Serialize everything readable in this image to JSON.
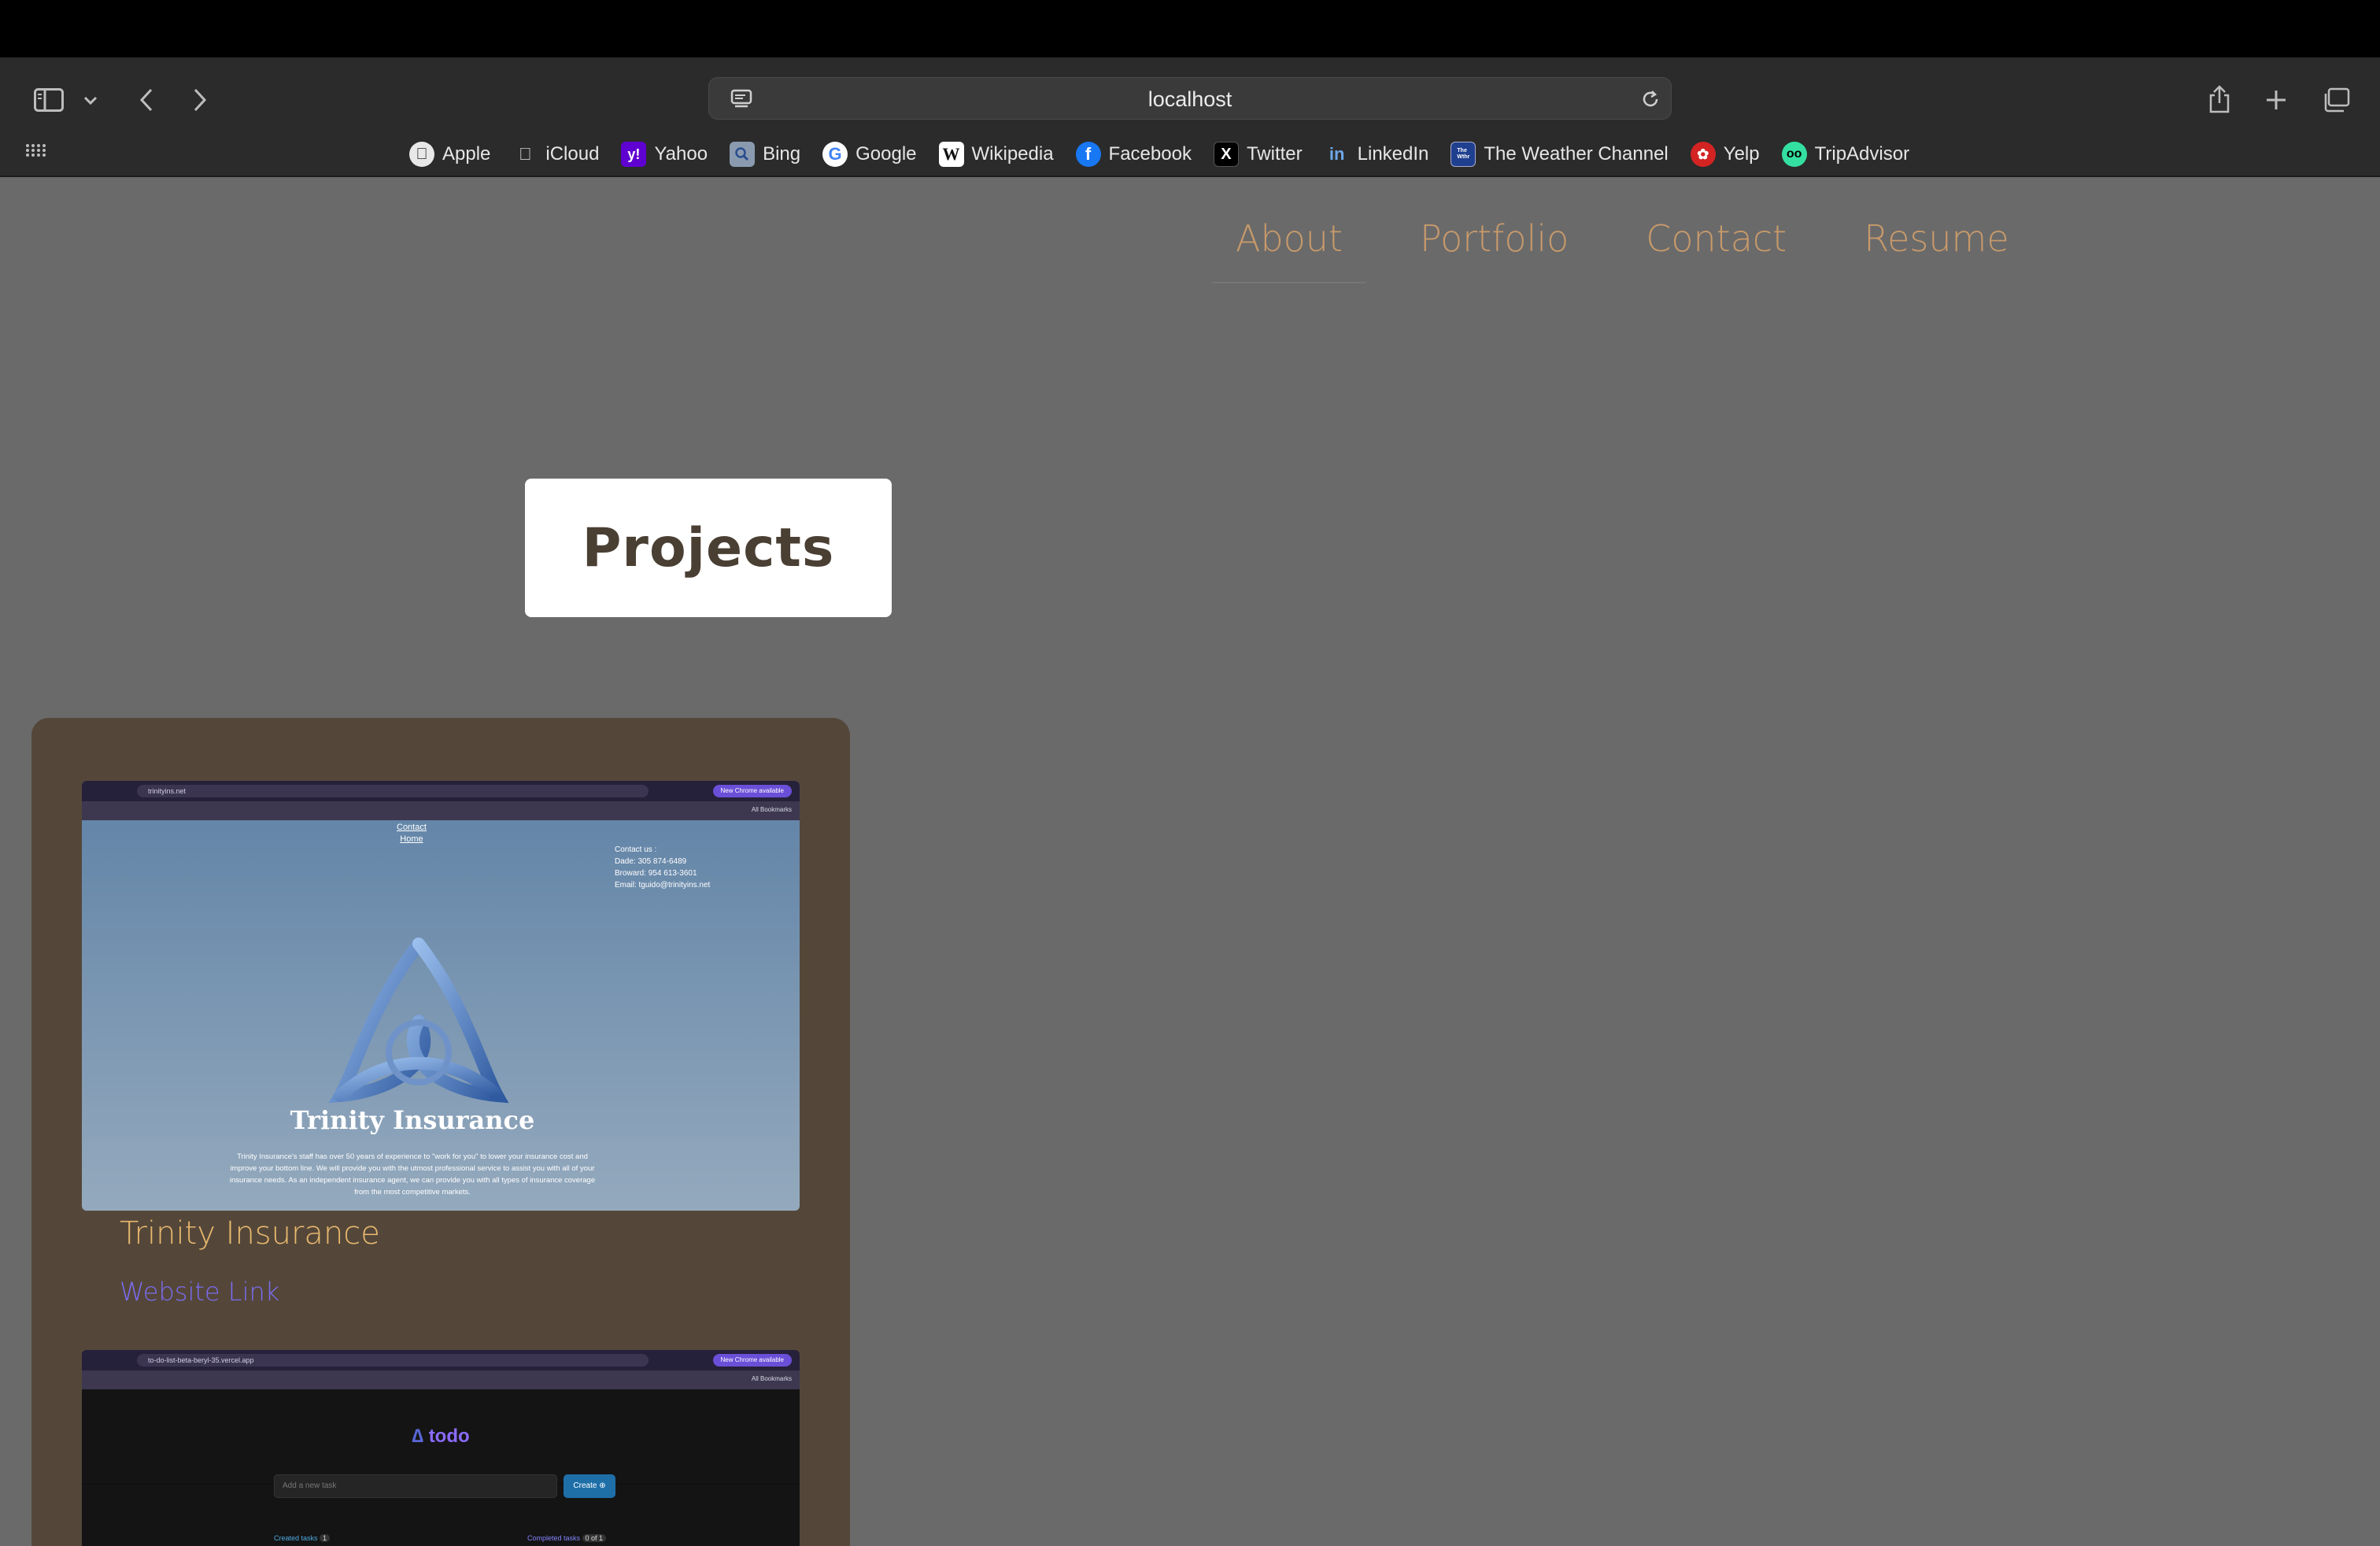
{
  "browser": {
    "address": "localhost",
    "bookmarks": [
      {
        "label": "Apple",
        "icon": "apple-icon",
        "color": "#333333"
      },
      {
        "label": "iCloud",
        "icon": "apple-icon",
        "color": "#2b2b2b"
      },
      {
        "label": "Yahoo",
        "icon": "yahoo-icon",
        "color": "#5f01d1"
      },
      {
        "label": "Bing",
        "icon": "bing-icon",
        "color": "#8a9bb0"
      },
      {
        "label": "Google",
        "icon": "google-icon",
        "color": "#ffffff"
      },
      {
        "label": "Wikipedia",
        "icon": "wikipedia-icon",
        "color": "#ffffff"
      },
      {
        "label": "Facebook",
        "icon": "facebook-icon",
        "color": "#1877f2"
      },
      {
        "label": "Twitter",
        "icon": "x-icon",
        "color": "#000000"
      },
      {
        "label": "LinkedIn",
        "icon": "linkedin-icon",
        "color": "#0a66c2"
      },
      {
        "label": "The Weather Channel",
        "icon": "weather-channel-icon",
        "color": "#1f3f8f"
      },
      {
        "label": "Yelp",
        "icon": "yelp-icon",
        "color": "#d32323"
      },
      {
        "label": "TripAdvisor",
        "icon": "tripadvisor-icon",
        "color": "#34e0a1"
      }
    ]
  },
  "nav": {
    "items": [
      "About",
      "Portfolio",
      "Contact",
      "Resume"
    ],
    "color": "#c89a6b"
  },
  "section": {
    "title": "Projects"
  },
  "projects": [
    {
      "name": "Trinity Insurance",
      "link_label": "Website Link",
      "screenshot": {
        "url": "trinityins.net",
        "chrome_button": "New Chrome available",
        "bookmarks_label": "All Bookmarks",
        "links": [
          "Contact",
          "Home"
        ],
        "contact": [
          "Contact us :",
          "Dade: 305 874-6489",
          "Broward: 954 613-3601",
          "Email: tguido@trinityins.net"
        ],
        "title": "Trinity Insurance",
        "description": "Trinity Insurance's staff has over 50 years of experience to \"work for you\" to lower your insurance cost and improve your bottom line. We will provide you with the utmost professional service to assist you with all of your insurance needs. As an independent insurance agent, we can provide you with all types of insurance coverage from the most competitive markets."
      }
    },
    {
      "screenshot": {
        "url": "to-do-list-beta-beryl-35.vercel.app",
        "chrome_button": "New Chrome available",
        "bookmarks_label": "All Bookmarks",
        "logo_text": "todo",
        "input_placeholder": "Add a new task",
        "create_label": "Create",
        "created_label": "Created tasks",
        "created_count": "1",
        "completed_label": "Completed tasks",
        "completed_count": "0 of 1"
      }
    }
  ]
}
